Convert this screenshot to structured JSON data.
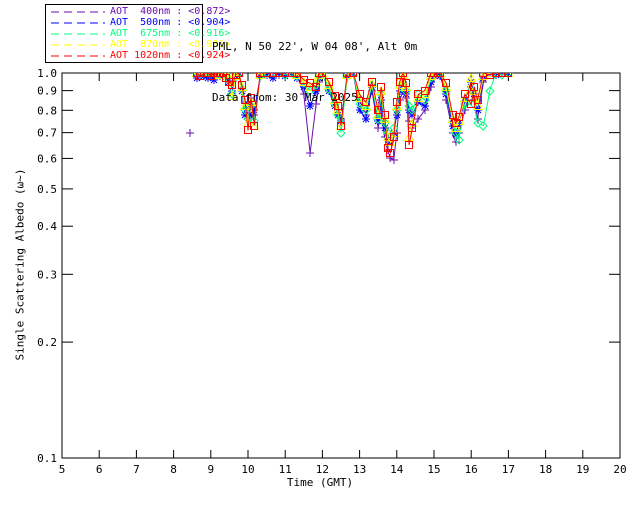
{
  "header": {
    "line1": "PML, N 50 22', W 04 08', Alt 0m",
    "line2": "Data from: 30 Mar 2025"
  },
  "chart_data": {
    "type": "line",
    "title": "",
    "xlabel": "Time (GMT)",
    "ylabel": "Single Scattering Albedo (ω~)",
    "xlim": [
      5,
      20
    ],
    "ylim": [
      0.1,
      1.0
    ],
    "yscale": "log",
    "grid": false,
    "legend_position": "top-left-above-plot",
    "axis_color": "#000000",
    "xticks": [
      5,
      6,
      7,
      8,
      9,
      10,
      11,
      12,
      13,
      14,
      15,
      16,
      17,
      18,
      19,
      20
    ],
    "yticks": [
      1.0,
      0.9,
      0.8,
      0.7,
      0.6,
      0.5,
      0.4,
      0.3,
      0.2,
      0.1
    ],
    "ytick_labels": [
      "1.0",
      "0.9",
      "0.8",
      "0.7",
      "0.6",
      "0.5",
      "0.4",
      "0.3",
      "0.2",
      "0.1"
    ],
    "times": [
      8.63,
      8.72,
      8.83,
      8.92,
      9.0,
      9.08,
      9.17,
      9.25,
      9.33,
      9.42,
      9.5,
      9.58,
      9.67,
      9.75,
      9.83,
      9.92,
      10.0,
      10.08,
      10.17,
      10.33,
      10.5,
      10.67,
      10.83,
      11.0,
      11.17,
      11.33,
      11.5,
      11.67,
      11.83,
      11.92,
      12.0,
      12.17,
      12.33,
      12.42,
      12.5,
      12.67,
      12.83,
      13.0,
      13.17,
      13.33,
      13.5,
      13.58,
      13.67,
      13.75,
      13.83,
      13.92,
      14.0,
      14.08,
      14.17,
      14.25,
      14.33,
      14.42,
      14.58,
      14.75,
      14.92,
      15.0,
      15.17,
      15.33,
      15.5,
      15.58,
      15.67,
      15.83,
      16.0,
      16.08,
      16.17,
      16.33,
      16.5,
      16.67,
      16.83,
      17.0
    ],
    "series": [
      {
        "label": "AOT  400nm : <0.872>",
        "wavelength": "400nm",
        "mean_ssa": "<0.872>",
        "color": "#6A0DAD",
        "marker": "plus",
        "isolated_point": [
          8.44,
          0.7
        ],
        "values": [
          0.99,
          1.0,
          1.0,
          1.0,
          1.0,
          0.99,
          1.0,
          1.0,
          0.98,
          1.0,
          0.97,
          0.9,
          0.97,
          1.0,
          0.92,
          0.84,
          0.8,
          0.86,
          0.78,
          0.97,
          1.0,
          1.0,
          0.99,
          1.0,
          1.0,
          0.98,
          0.88,
          0.62,
          0.83,
          0.95,
          1.0,
          0.92,
          0.84,
          0.8,
          0.76,
          0.97,
          1.0,
          0.85,
          0.78,
          0.9,
          0.72,
          0.8,
          0.68,
          0.63,
          0.6,
          0.595,
          0.7,
          0.85,
          0.9,
          0.86,
          0.75,
          0.72,
          0.76,
          0.8,
          0.92,
          0.97,
          1.0,
          0.85,
          0.7,
          0.66,
          0.7,
          0.8,
          0.92,
          0.85,
          0.76,
          0.95,
          1.0,
          1.0,
          1.0,
          1.0
        ]
      },
      {
        "label": "AOT  500nm : <0.904>",
        "wavelength": "500nm",
        "mean_ssa": "<0.904>",
        "color": "#0000FF",
        "marker": "asterisk",
        "values": [
          0.97,
          1.0,
          0.98,
          0.97,
          0.99,
          0.96,
          1.0,
          0.98,
          1.0,
          0.98,
          0.95,
          0.9,
          0.98,
          1.0,
          0.9,
          0.78,
          0.83,
          0.77,
          0.8,
          0.98,
          0.99,
          0.97,
          1.0,
          0.98,
          1.0,
          0.97,
          0.92,
          0.82,
          0.9,
          0.97,
          1.0,
          0.9,
          0.82,
          0.78,
          0.75,
          0.98,
          1.0,
          0.8,
          0.76,
          0.92,
          0.75,
          0.85,
          0.72,
          0.68,
          0.66,
          0.7,
          0.78,
          0.9,
          0.95,
          0.88,
          0.8,
          0.78,
          0.84,
          0.82,
          0.95,
          1.0,
          0.98,
          0.88,
          0.73,
          0.69,
          0.74,
          0.85,
          0.95,
          0.88,
          0.8,
          0.97,
          1.0,
          0.99,
          1.0,
          1.0
        ]
      },
      {
        "label": "AOT  675nm : <0.916>",
        "wavelength": "675nm",
        "mean_ssa": "<0.916>",
        "color": "#00FF7F",
        "marker": "diamond",
        "values": [
          1.0,
          1.0,
          1.0,
          1.0,
          1.0,
          1.0,
          0.99,
          1.0,
          1.0,
          0.99,
          0.96,
          0.88,
          0.98,
          1.0,
          0.91,
          0.8,
          0.76,
          0.82,
          0.75,
          0.98,
          1.0,
          1.0,
          1.0,
          0.99,
          1.0,
          0.98,
          0.94,
          0.9,
          0.93,
          0.98,
          1.0,
          0.91,
          0.83,
          0.78,
          0.7,
          0.98,
          1.0,
          0.83,
          0.8,
          0.93,
          0.76,
          0.88,
          0.74,
          0.7,
          0.68,
          0.72,
          0.8,
          0.92,
          0.97,
          0.9,
          0.82,
          0.8,
          0.88,
          0.85,
          0.97,
          1.0,
          1.0,
          0.9,
          0.75,
          0.7,
          0.67,
          0.83,
          0.9,
          0.83,
          0.74,
          0.73,
          0.9,
          1.0,
          0.99,
          1.0
        ]
      },
      {
        "label": "AOT  870nm : <0.931>",
        "wavelength": "870nm",
        "mean_ssa": "<0.931>",
        "color": "#FFFF00",
        "marker": "triangle",
        "values": [
          1.0,
          1.0,
          1.0,
          1.0,
          1.0,
          1.0,
          1.0,
          0.99,
          1.0,
          1.0,
          0.97,
          0.87,
          0.98,
          1.0,
          0.92,
          0.82,
          0.74,
          0.84,
          0.73,
          0.99,
          1.0,
          1.0,
          1.0,
          1.0,
          1.0,
          0.99,
          0.95,
          0.92,
          0.95,
          0.99,
          1.0,
          0.93,
          0.85,
          0.8,
          0.73,
          0.99,
          1.0,
          0.86,
          0.82,
          0.94,
          0.78,
          0.9,
          0.76,
          0.68,
          0.66,
          0.7,
          0.82,
          0.93,
          0.98,
          0.92,
          0.68,
          0.74,
          0.86,
          0.88,
          0.98,
          1.0,
          1.0,
          0.92,
          0.76,
          0.72,
          0.75,
          0.86,
          0.97,
          0.9,
          0.82,
          0.98,
          1.0,
          1.0,
          1.0,
          1.0
        ]
      },
      {
        "label": "AOT 1020nm : <0.924>",
        "wavelength": "1020nm",
        "mean_ssa": "<0.924>",
        "color": "#FF0000",
        "marker": "square",
        "values": [
          1.0,
          0.98,
          1.0,
          1.0,
          0.98,
          1.0,
          1.0,
          1.0,
          1.0,
          0.97,
          0.95,
          0.93,
          0.99,
          1.0,
          0.93,
          0.85,
          0.71,
          0.86,
          0.73,
          1.0,
          1.0,
          1.0,
          1.0,
          1.0,
          1.0,
          1.0,
          0.96,
          0.94,
          0.92,
          1.0,
          1.0,
          0.95,
          0.87,
          0.82,
          0.73,
          1.0,
          1.0,
          0.88,
          0.84,
          0.95,
          0.8,
          0.92,
          0.78,
          0.64,
          0.62,
          0.68,
          0.84,
          0.95,
          1.0,
          0.94,
          0.65,
          0.72,
          0.88,
          0.9,
          1.0,
          1.0,
          1.0,
          0.94,
          0.78,
          0.74,
          0.77,
          0.88,
          0.83,
          0.92,
          0.85,
          1.0,
          0.99,
          1.0,
          1.0,
          1.0
        ]
      }
    ]
  }
}
